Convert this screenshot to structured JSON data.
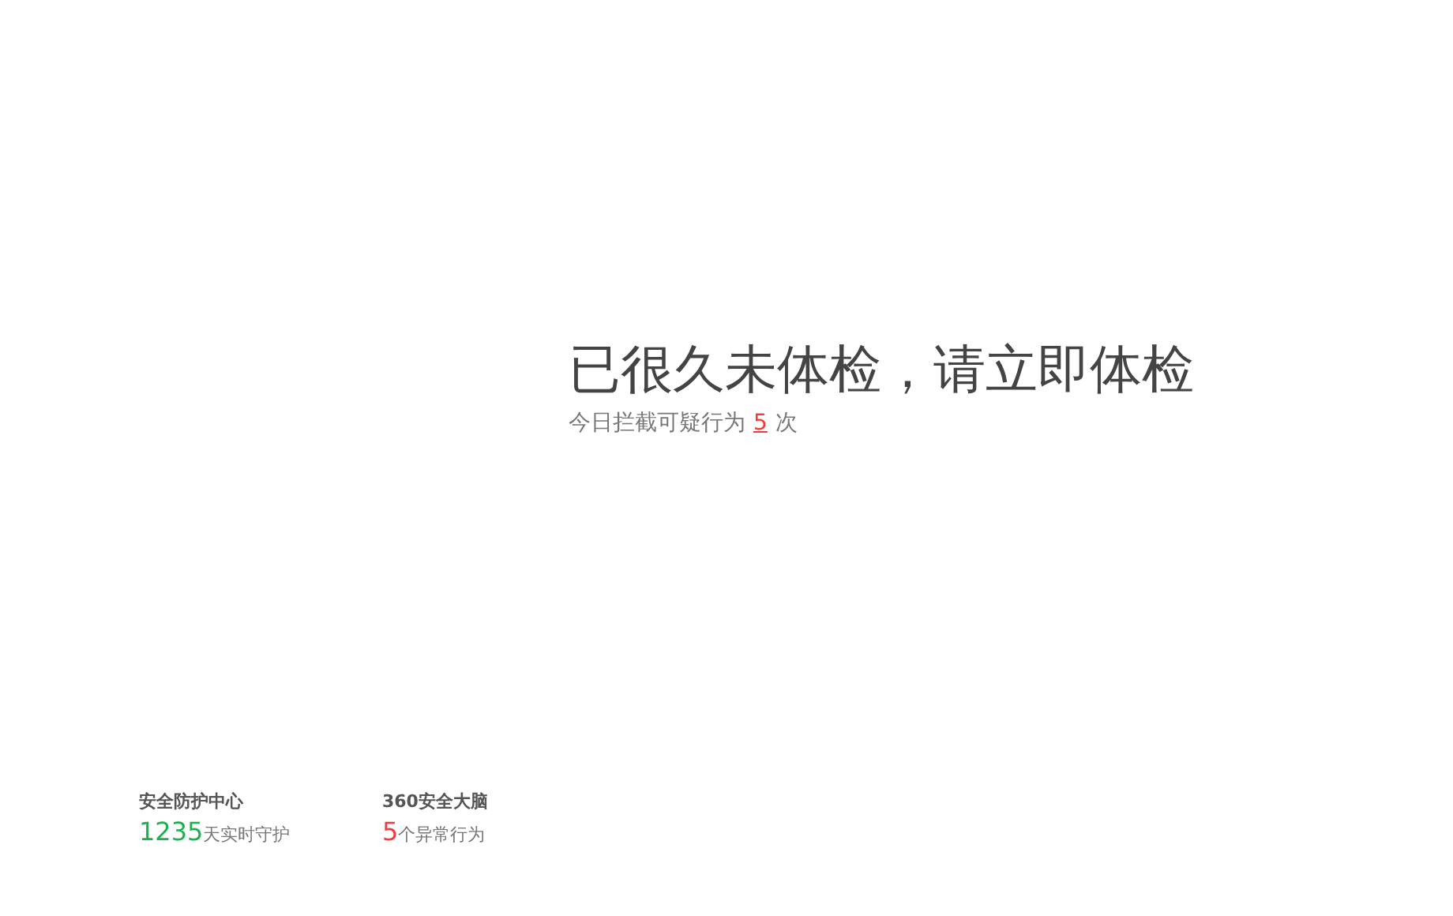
{
  "headline": "已很久未体检，请立即体检",
  "subline": {
    "prefix": "今日拦截可疑行为",
    "count": "5",
    "suffix": "次"
  },
  "stats": [
    {
      "title": "安全防护中心",
      "value": "1235",
      "unit": "天实时守护",
      "color": "#1bb14c"
    },
    {
      "title": "360安全大脑",
      "value": "5",
      "unit": "个异常行为",
      "color": "#f23b3b"
    }
  ]
}
